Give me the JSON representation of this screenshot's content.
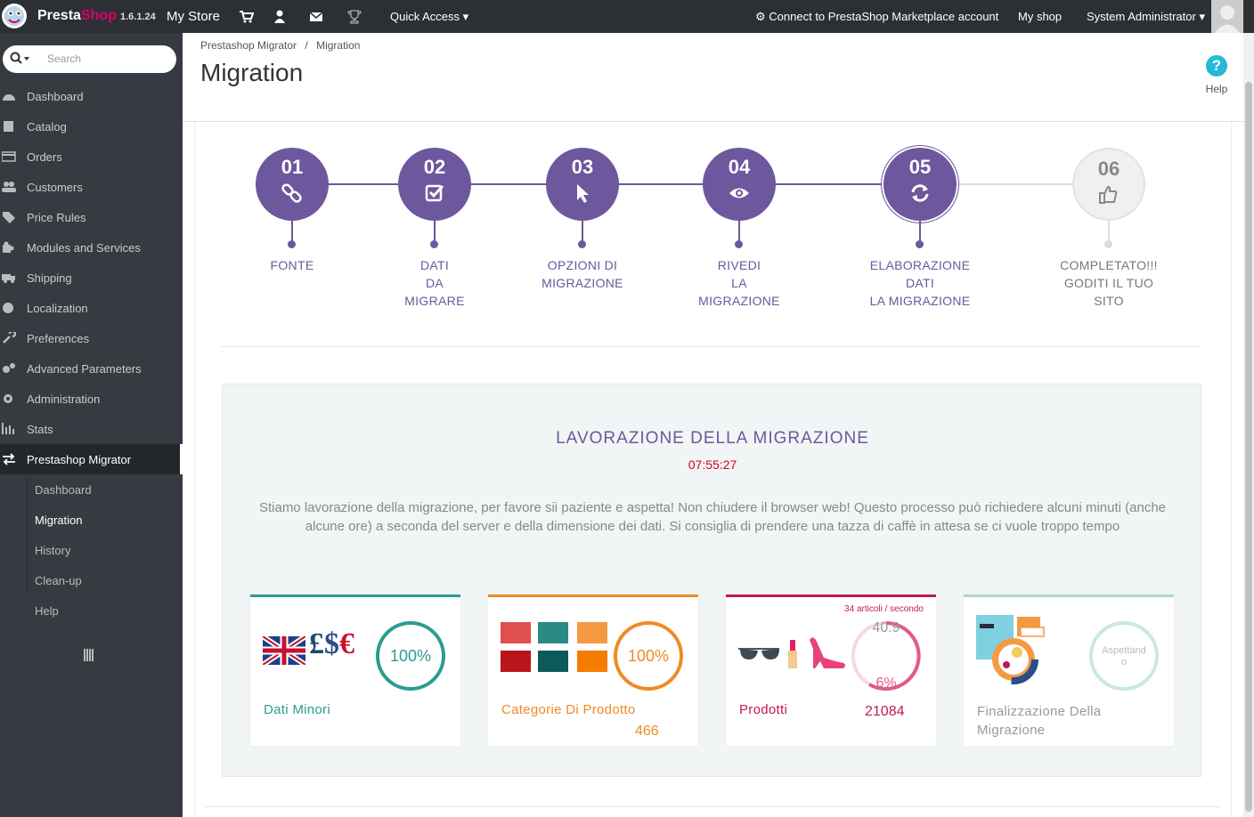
{
  "topbar": {
    "brand_a": "Presta",
    "brand_b": "Shop",
    "version": "1.6.1.24",
    "store": "My Store",
    "quick_access": "Quick Access",
    "connect": "Connect to PrestaShop Marketplace account",
    "my_shop": "My shop",
    "user": "System Administrator"
  },
  "search": {
    "placeholder": "Search"
  },
  "sidebar": {
    "items": [
      {
        "label": "Dashboard"
      },
      {
        "label": "Catalog"
      },
      {
        "label": "Orders"
      },
      {
        "label": "Customers"
      },
      {
        "label": "Price Rules"
      },
      {
        "label": "Modules and Services"
      },
      {
        "label": "Shipping"
      },
      {
        "label": "Localization"
      },
      {
        "label": "Preferences"
      },
      {
        "label": "Advanced Parameters"
      },
      {
        "label": "Administration"
      },
      {
        "label": "Stats"
      },
      {
        "label": "Prestashop Migrator"
      }
    ],
    "sub": [
      {
        "label": "Dashboard"
      },
      {
        "label": "Migration"
      },
      {
        "label": "History"
      },
      {
        "label": "Clean-up"
      },
      {
        "label": "Help"
      }
    ]
  },
  "header": {
    "breadcrumb": [
      "Prestashop Migrator",
      "/",
      "Migration"
    ],
    "title": "Migration",
    "help": "Help"
  },
  "steps": [
    {
      "num": "01",
      "label": [
        "FONTE"
      ]
    },
    {
      "num": "02",
      "label": [
        "DATI",
        "DA",
        "MIGRARE"
      ]
    },
    {
      "num": "03",
      "label": [
        "OPZIONI DI",
        "MIGRAZIONE"
      ]
    },
    {
      "num": "04",
      "label": [
        "RIVEDI",
        "LA",
        "MIGRAZIONE"
      ]
    },
    {
      "num": "05",
      "label": [
        "ELABORAZIONE",
        "DATI",
        "LA MIGRAZIONE"
      ]
    },
    {
      "num": "06",
      "label": [
        "COMPLETATO!!!",
        "GODITI IL TUO",
        "SITO"
      ]
    }
  ],
  "work": {
    "title": "LAVORAZIONE DELLA MIGRAZIONE",
    "timer": "07:55:27",
    "desc": "Stiamo lavorazione della migrazione, per favore sii paziente e aspetta! Non chiudere il browser web! Questo processo può richiedere alcuni minuti (anche alcune ore) a seconda del server e della dimensione dei dati. Si consiglia di prendere una tazza di caffè in attesa se ci vuole troppo tempo"
  },
  "cards": [
    {
      "name": "Dati Minori",
      "ring": "100%",
      "count": "",
      "color": "#2a9d8f",
      "progress": 1.0,
      "symbols": "£$€"
    },
    {
      "name": "Categorie Di Prodotto",
      "ring": "100%",
      "count": "466",
      "color": "#f08a24",
      "progress": 1.0
    },
    {
      "name": "Prodotti",
      "ring_top": "40.9",
      "ring_bottom": "6%",
      "count": "21084",
      "rate": "34 articoli / secondo",
      "color": "#c2185b",
      "progress": 0.06
    },
    {
      "name": "Finalizzazione Della",
      "name2": "Migrazione",
      "ring": "Aspettand",
      "ring2": "o",
      "count": "",
      "color": "#a9d8d3",
      "progress": 0
    }
  ]
}
